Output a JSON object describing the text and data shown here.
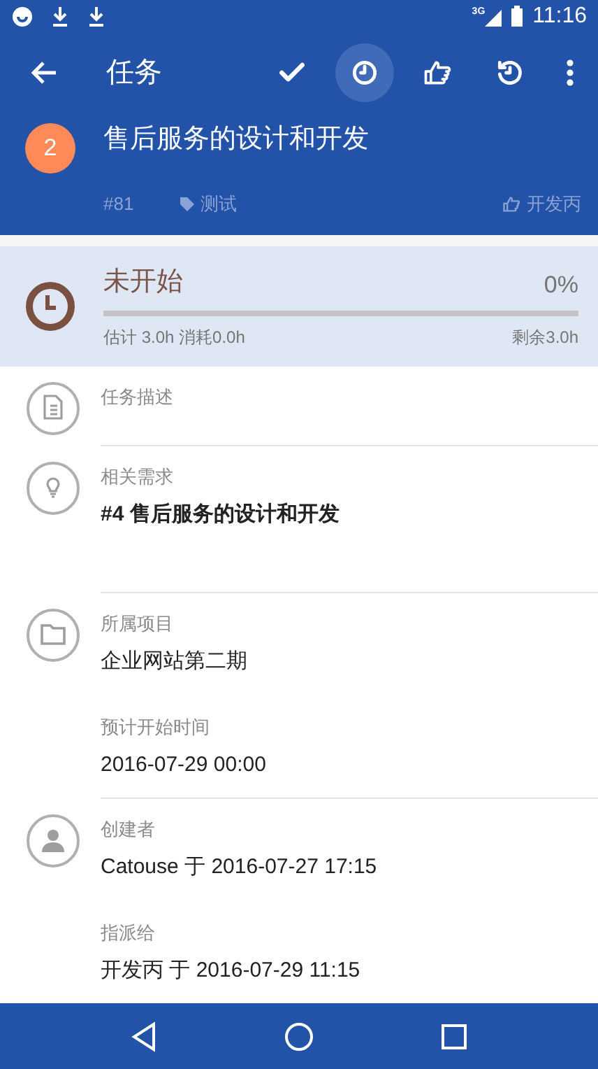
{
  "status_bar": {
    "time": "11:16",
    "network": "3G"
  },
  "toolbar": {
    "title": "任务",
    "actions": [
      {
        "kind": "check",
        "pressed": false
      },
      {
        "kind": "clock",
        "pressed": true
      },
      {
        "kind": "thumb",
        "pressed": false
      },
      {
        "kind": "history",
        "pressed": false
      },
      {
        "kind": "more",
        "pressed": false
      }
    ]
  },
  "task": {
    "priority": "2",
    "title": "售后服务的设计和开发",
    "id": "#81",
    "tag": "测试",
    "assignee": "开发丙"
  },
  "progress": {
    "status": "未开始",
    "percent": "0%",
    "level": 0,
    "estimate": "估计 3.0h 消耗0.0h",
    "remaining": "剩余3.0h"
  },
  "sections": [
    {
      "kind": "document",
      "fields": [
        {
          "label": "任务描述"
        }
      ]
    },
    {
      "kind": "bulb",
      "fields": [
        {
          "label": "相关需求",
          "value": "#4 售后服务的设计和开发",
          "bold": true
        }
      ]
    },
    {
      "kind": "folder",
      "fields": [
        {
          "label": "所属项目",
          "value": "企业网站第二期",
          "bold": false
        },
        {
          "label": "预计开始时间",
          "value": "2016-07-29 00:00",
          "bold": false
        }
      ]
    },
    {
      "kind": "person",
      "fields": [
        {
          "label": "创建者",
          "value": "Catouse 于 2016-07-27 17:15",
          "bold": false
        },
        {
          "label": "指派给",
          "value": "开发丙 于 2016-07-29 11:15",
          "bold": false
        }
      ]
    }
  ]
}
